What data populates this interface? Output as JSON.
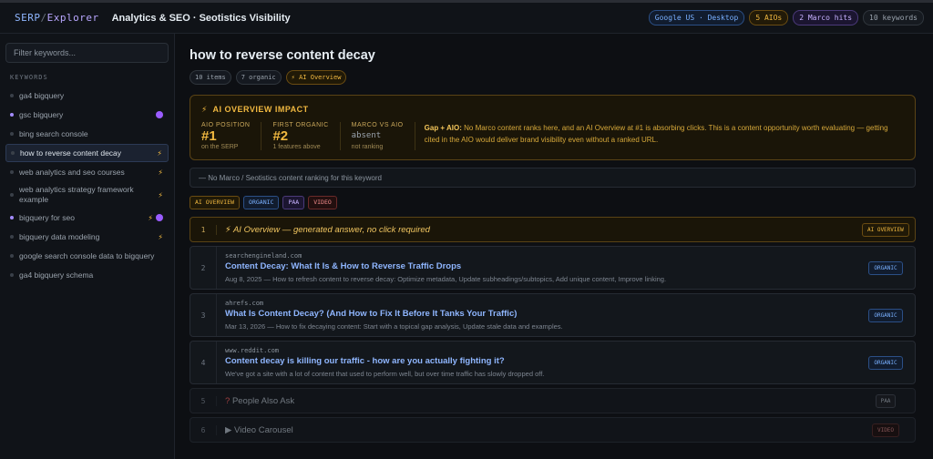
{
  "header": {
    "brand_serp": "SERP",
    "brand_slash": "/",
    "brand_explorer": "Explorer",
    "title": "Analytics & SEO · Seotistics Visibility",
    "pills": {
      "locale": "Google US · Desktop",
      "aios": "5 AIOs",
      "marco": "2 Marco hits",
      "keywords": "10 keywords"
    }
  },
  "sidebar": {
    "search_placeholder": "Filter keywords...",
    "section_label": "KEYWORDS",
    "items": [
      {
        "label": "ga4 bigquery",
        "dot": false,
        "bolt": false,
        "marco": false
      },
      {
        "label": "gsc bigquery",
        "dot": true,
        "bolt": false,
        "marco": true
      },
      {
        "label": "bing search console",
        "dot": false,
        "bolt": false,
        "marco": false
      },
      {
        "label": "how to reverse content decay",
        "dot": false,
        "bolt": true,
        "marco": false,
        "active": true
      },
      {
        "label": "web analytics and seo courses",
        "dot": false,
        "bolt": true,
        "marco": false
      },
      {
        "label": "web analytics strategy framework example",
        "dot": false,
        "bolt": true,
        "marco": false
      },
      {
        "label": "bigquery for seo",
        "dot": true,
        "bolt": true,
        "marco": true
      },
      {
        "label": "bigquery data modeling",
        "dot": false,
        "bolt": true,
        "marco": false
      },
      {
        "label": "google search console data to bigquery",
        "dot": false,
        "bolt": false,
        "marco": false
      },
      {
        "label": "ga4 bigquery schema",
        "dot": false,
        "bolt": false,
        "marco": false
      }
    ]
  },
  "main": {
    "keyword_title": "how to reverse content decay",
    "meta": {
      "items": "10 items",
      "organic": "7 organic",
      "aio": "⚡ AI Overview"
    },
    "impact": {
      "heading": "AI OVERVIEW IMPACT",
      "icon": "bolt-icon",
      "aio_position_label": "AIO POSITION",
      "aio_position_value": "#1",
      "aio_position_sub": "on the SERP",
      "first_organic_label": "FIRST ORGANIC",
      "first_organic_value": "#2",
      "first_organic_sub": "1 features above",
      "marco_label": "MARCO VS AIO",
      "marco_value": "absent",
      "marco_sub": "not ranking",
      "gap_prefix": "Gap + AIO:",
      "gap_text": " No Marco content ranks here, and an AI Overview at #1 is absorbing clicks. This is a content opportunity worth evaluating — getting cited in the AIO would deliver brand visibility even without a ranked URL."
    },
    "no_marco": "— No Marco / Seotistics content ranking for this keyword",
    "filters": {
      "aio": "AI OVERVIEW",
      "organic": "ORGANIC",
      "paa": "PAA",
      "video": "VIDEO"
    },
    "results": [
      {
        "pos": "1",
        "type": "aio",
        "text": "⚡ AI Overview — generated answer, no click required",
        "tag": "AI OVERVIEW"
      },
      {
        "pos": "2",
        "type": "organic",
        "domain": "searchengineland.com",
        "title": "Content Decay: What It Is & How to Reverse Traffic Drops",
        "snippet": "Aug 8, 2025 — How to refresh content to reverse decay: Optimize metadata, Update subheadings/subtopics, Add unique content, Improve linking.",
        "tag": "ORGANIC"
      },
      {
        "pos": "3",
        "type": "organic",
        "domain": "ahrefs.com",
        "title": "What Is Content Decay? (And How to Fix It Before It Tanks Your Traffic)",
        "snippet": "Mar 13, 2026 — How to fix decaying content: Start with a topical gap analysis, Update stale data and examples.",
        "tag": "ORGANIC"
      },
      {
        "pos": "4",
        "type": "organic",
        "domain": "www.reddit.com",
        "title": "Content decay is killing our traffic - how are you actually fighting it?",
        "snippet": "We've got a site with a lot of content that used to perform well, but over time traffic has slowly dropped off.",
        "tag": "ORGANIC"
      },
      {
        "pos": "5",
        "type": "paa",
        "icon": "?",
        "text": "People Also Ask",
        "tag": "PAA"
      },
      {
        "pos": "6",
        "type": "video",
        "icon": "▶",
        "text": "Video Carousel",
        "tag": "VIDEO"
      }
    ]
  }
}
